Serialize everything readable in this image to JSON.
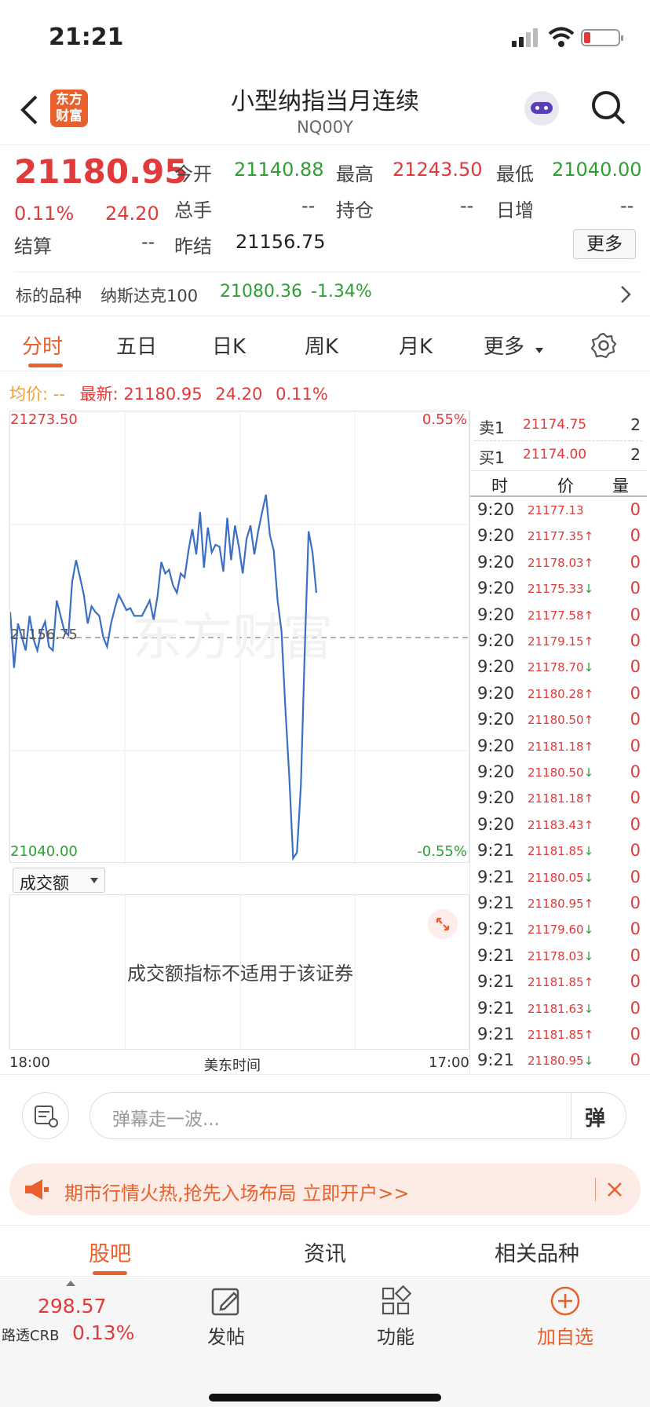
{
  "status_bar": {
    "time": "21:21"
  },
  "header": {
    "title": "小型纳指当月连续",
    "code": "NQ00Y",
    "logo_line1": "东方",
    "logo_line2": "财富"
  },
  "quote": {
    "price": "21180.95",
    "pct": "0.11%",
    "change": "24.20",
    "open_label": "今开",
    "open": "21140.88",
    "high_label": "最高",
    "high": "21243.50",
    "low_label": "最低",
    "low": "21040.00",
    "volume_label": "总手",
    "volume": "--",
    "oi_label": "持仓",
    "oi": "--",
    "daily_inc_label": "日增",
    "daily_inc": "--",
    "settle_label": "结算",
    "settle": "--",
    "prev_settle_label": "昨结",
    "prev_settle": "21156.75",
    "more_button": "更多"
  },
  "underlying": {
    "label": "标的品种",
    "name": "纳斯达克100",
    "price": "21080.36",
    "pct": "-1.34%"
  },
  "tabs": [
    {
      "label": "分时",
      "active": true
    },
    {
      "label": "五日"
    },
    {
      "label": "日K"
    },
    {
      "label": "周K"
    },
    {
      "label": "月K"
    },
    {
      "label": "更多"
    }
  ],
  "info_line": {
    "avg_label": "均价:",
    "avg": "--",
    "latest_label": "最新:",
    "latest": "21180.95",
    "change": "24.20",
    "pct": "0.11%"
  },
  "chart_data": {
    "type": "line",
    "series": [
      {
        "values": [
          21170,
          21141,
          21164,
          21157,
          21150,
          21168,
          21156,
          21150,
          21160,
          21165,
          21152,
          21150,
          21176,
          21168,
          21160,
          21158,
          21186,
          21197,
          21188,
          21179,
          21164,
          21173,
          21170,
          21168,
          21157,
          21152,
          21164,
          21172,
          21179,
          21175,
          21171,
          21172,
          21168,
          21168,
          21168,
          21172,
          21176,
          21166,
          21178,
          21196,
          21190,
          21192,
          21184,
          21180,
          21190,
          21188,
          21202,
          21213,
          21200,
          21222,
          21193,
          21214,
          21201,
          21205,
          21204,
          21191,
          21219,
          21197,
          21215,
          21204,
          21190,
          21208,
          21215,
          21200,
          21212,
          21222,
          21231,
          21210,
          21202,
          21176,
          21160,
          21120,
          21085,
          21042,
          21045,
          21080,
          21150,
          21212,
          21201,
          21180
        ]
      }
    ],
    "ylim": [
      21040.0,
      21273.5
    ],
    "y_top_label": "21273.50",
    "y_bottom_label": "21040.00",
    "y_mid_label": "21156.75",
    "pct_top": "0.55%",
    "pct_bottom": "-0.55%",
    "x_start": "18:00",
    "x_mid": "美东时间",
    "x_end": "17:00"
  },
  "orderbook": {
    "sell_label": "卖1",
    "sell_price": "21174.75",
    "sell_qty": "2",
    "buy_label": "买1",
    "buy_price": "21174.00",
    "buy_qty": "2"
  },
  "trades_header": {
    "time": "时",
    "price": "价",
    "qty": "量"
  },
  "trades": [
    {
      "t": "9:20",
      "p": "21177.13",
      "a": "",
      "v": "0"
    },
    {
      "t": "9:20",
      "p": "21177.35",
      "a": "↑",
      "v": "0"
    },
    {
      "t": "9:20",
      "p": "21178.03",
      "a": "↑",
      "v": "0"
    },
    {
      "t": "9:20",
      "p": "21175.33",
      "a": "↓",
      "v": "0"
    },
    {
      "t": "9:20",
      "p": "21177.58",
      "a": "↑",
      "v": "0"
    },
    {
      "t": "9:20",
      "p": "21179.15",
      "a": "↑",
      "v": "0"
    },
    {
      "t": "9:20",
      "p": "21178.70",
      "a": "↓",
      "v": "0"
    },
    {
      "t": "9:20",
      "p": "21180.28",
      "a": "↑",
      "v": "0"
    },
    {
      "t": "9:20",
      "p": "21180.50",
      "a": "↑",
      "v": "0"
    },
    {
      "t": "9:20",
      "p": "21181.18",
      "a": "↑",
      "v": "0"
    },
    {
      "t": "9:20",
      "p": "21180.50",
      "a": "↓",
      "v": "0"
    },
    {
      "t": "9:20",
      "p": "21181.18",
      "a": "↑",
      "v": "0"
    },
    {
      "t": "9:20",
      "p": "21183.43",
      "a": "↑",
      "v": "0"
    },
    {
      "t": "9:21",
      "p": "21181.85",
      "a": "↓",
      "v": "0"
    },
    {
      "t": "9:21",
      "p": "21180.05",
      "a": "↓",
      "v": "0"
    },
    {
      "t": "9:21",
      "p": "21180.95",
      "a": "↑",
      "v": "0"
    },
    {
      "t": "9:21",
      "p": "21179.60",
      "a": "↓",
      "v": "0"
    },
    {
      "t": "9:21",
      "p": "21178.03",
      "a": "↓",
      "v": "0"
    },
    {
      "t": "9:21",
      "p": "21181.85",
      "a": "↑",
      "v": "0"
    },
    {
      "t": "9:21",
      "p": "21181.63",
      "a": "↓",
      "v": "0"
    },
    {
      "t": "9:21",
      "p": "21181.85",
      "a": "↑",
      "v": "0"
    },
    {
      "t": "9:21",
      "p": "21180.95",
      "a": "↓",
      "v": "0"
    }
  ],
  "volume_panel": {
    "selector": "成交额",
    "message": "成交额指标不适用于该证券"
  },
  "comment": {
    "placeholder": "弹幕走一波...",
    "danmu_button": "弹"
  },
  "promo": {
    "text": "期市行情火热,抢先入场布局 立即开户>>"
  },
  "bottom_tabs": [
    {
      "label": "股吧",
      "active": true
    },
    {
      "label": "资讯"
    },
    {
      "label": "相关品种"
    }
  ],
  "footer": {
    "index_value": "298.57",
    "index_name": "路透CRB",
    "index_pct": "0.13%",
    "post": "发帖",
    "func": "功能",
    "add": "加自选"
  },
  "colors": {
    "red": "#e03a3a",
    "green": "#2ea033",
    "line": "#3a6fc4",
    "accent": "#e8602c"
  }
}
